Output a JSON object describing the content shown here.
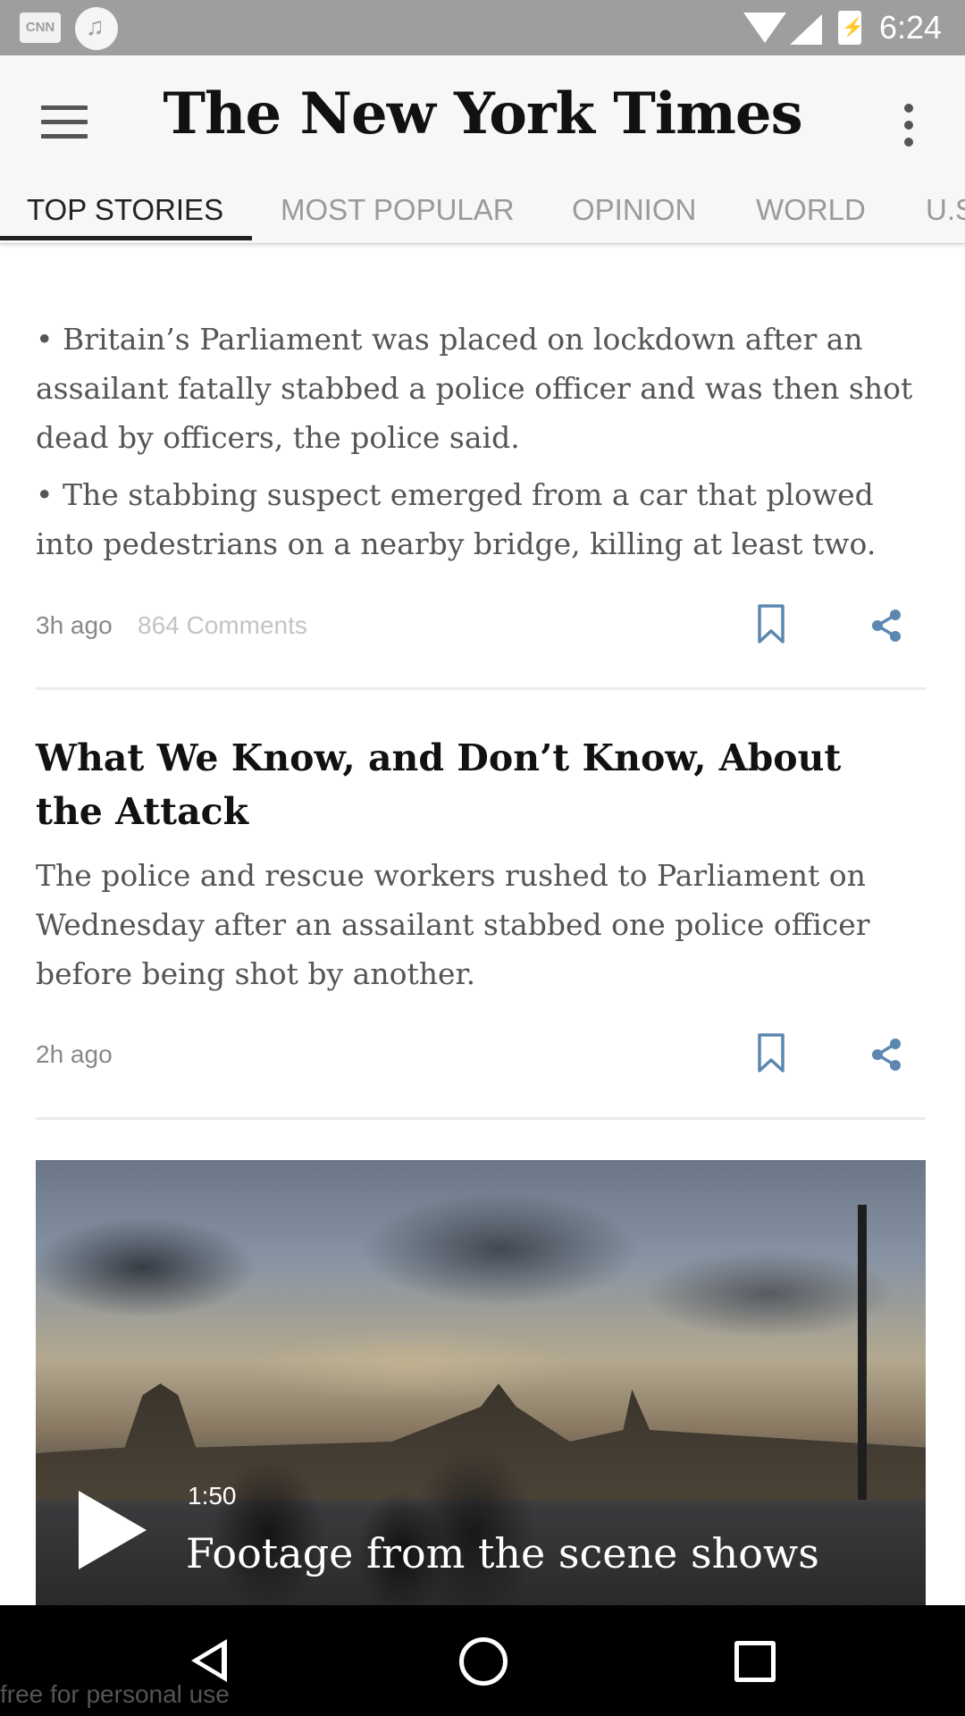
{
  "status_bar": {
    "time": "6:24",
    "notification_icons": [
      "cnn-icon",
      "music-icon"
    ],
    "system_icons": [
      "wifi-icon",
      "cell-signal-icon",
      "battery-charging-icon"
    ],
    "cnn_label": "CNN"
  },
  "app_bar": {
    "title": "The New York Times",
    "menu_icon": "hamburger-menu-icon",
    "overflow_icon": "more-vert-icon"
  },
  "tabs": [
    {
      "label": "TOP STORIES",
      "active": true
    },
    {
      "label": "MOST POPULAR",
      "active": false
    },
    {
      "label": "OPINION",
      "active": false
    },
    {
      "label": "WORLD",
      "active": false
    },
    {
      "label": "U.S",
      "active": false
    }
  ],
  "articles": [
    {
      "bullets": [
        "• Britain’s Parliament was placed on lockdown after an assailant fatally stabbed a police officer and was then shot dead by officers, the police said.",
        "• The stabbing suspect emerged from a car that plowed into pedestrians on a nearby bridge, killing at least two."
      ],
      "time": "3h ago",
      "comments": "864 Comments"
    },
    {
      "headline": "What We Know, and Don’t Know, About the Attack",
      "summary": "The police and rescue workers rushed to Parliament on Wednesday after an assailant stabbed one police officer before being shot by another.",
      "time": "2h ago"
    }
  ],
  "video": {
    "duration": "1:50",
    "title": "Footage from the scene shows"
  },
  "watermark": "free for personal use",
  "colors": {
    "accent_icon": "#5b87b1",
    "tab_active": "#222222",
    "tab_inactive": "#9a9a9a",
    "status_bar": "#9e9e9e"
  }
}
